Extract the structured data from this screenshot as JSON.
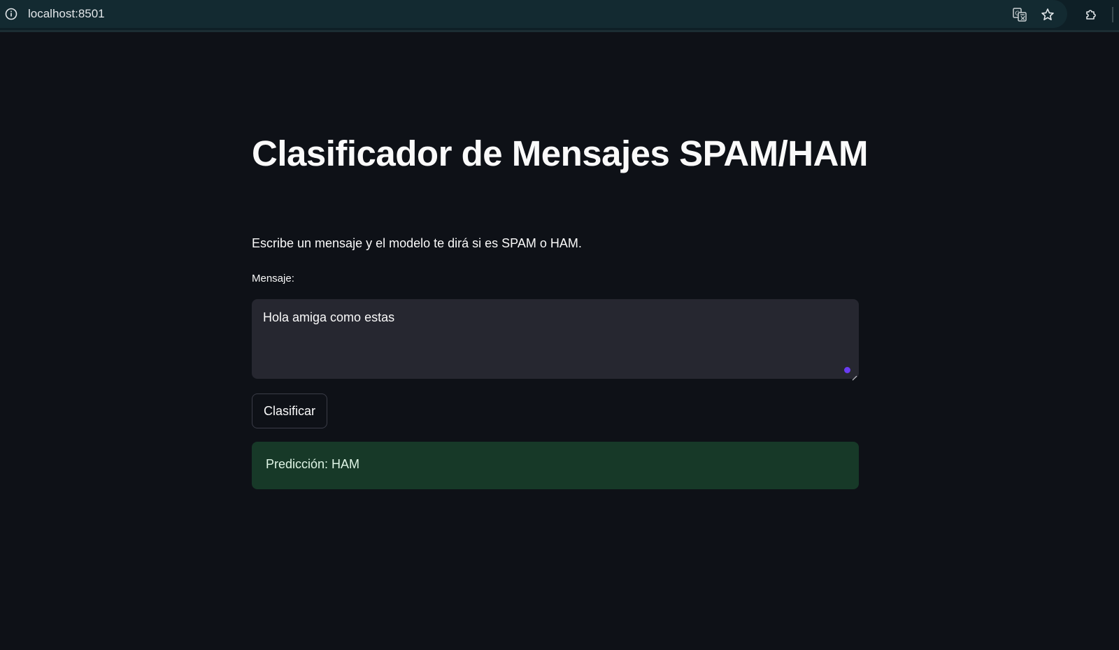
{
  "browser": {
    "url": "localhost:8501",
    "icons": [
      "site-info-icon",
      "translate-icon",
      "star-icon",
      "extensions-icon"
    ]
  },
  "app": {
    "title": "Clasificador de Mensajes SPAM/HAM",
    "description": "Escribe un mensaje y el modelo te dirá si es SPAM o HAM.",
    "message_label": "Mensaje:",
    "message_value": "Hola amiga como estas",
    "classify_button": "Clasificar",
    "result": "Predicción: HAM"
  },
  "colors": {
    "background": "#0e1117",
    "input_background": "#262730",
    "success_background": "#173928",
    "success_text": "#dff5e6"
  }
}
